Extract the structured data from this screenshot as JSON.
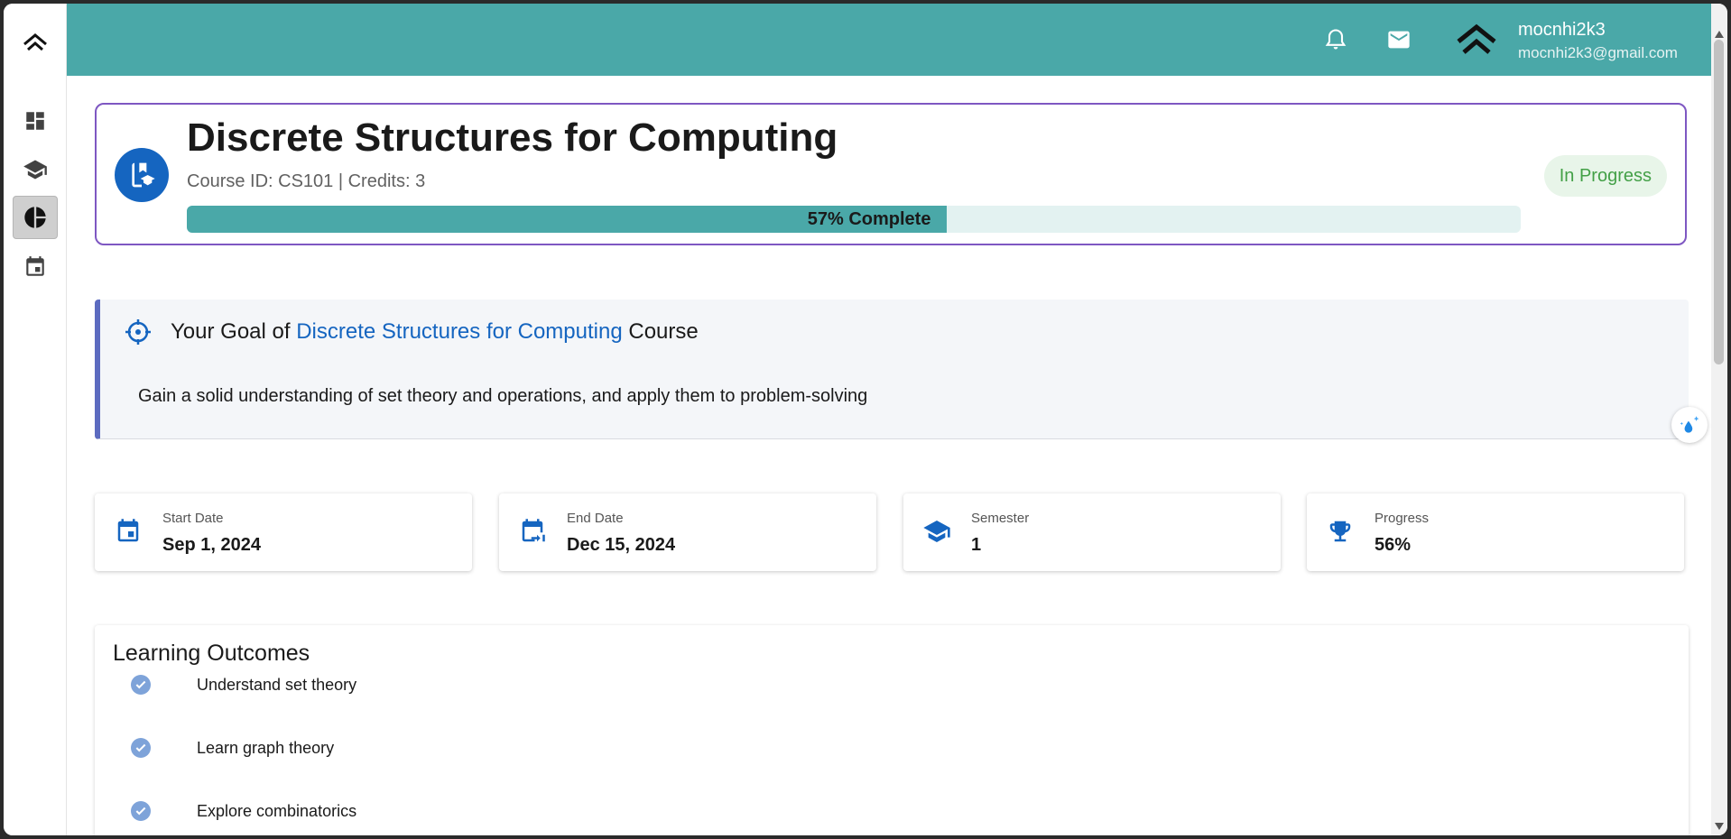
{
  "user": {
    "name": "mocnhi2k3",
    "email": "mocnhi2k3@gmail.com"
  },
  "course": {
    "title": "Discrete Structures for Computing",
    "meta": "Course ID: CS101 | Credits: 3",
    "progress_label": "57% Complete",
    "progress_fraction": 0.57,
    "status": "In Progress"
  },
  "goal": {
    "prefix": "Your Goal of",
    "course_link": "Discrete Structures for Computing",
    "suffix": "Course",
    "text": "Gain a solid understanding of set theory and operations, and apply them to problem-solving"
  },
  "stats": [
    {
      "label": "Start Date",
      "value": "Sep 1, 2024",
      "icon": "calendar-icon"
    },
    {
      "label": "End Date",
      "value": "Dec 15, 2024",
      "icon": "calendar-end-icon"
    },
    {
      "label": "Semester",
      "value": "1",
      "icon": "school-icon"
    },
    {
      "label": "Progress",
      "value": "56%",
      "icon": "trophy-icon"
    }
  ],
  "outcomes": {
    "title": "Learning Outcomes",
    "items": [
      "Understand set theory",
      "Learn graph theory",
      "Explore combinatorics"
    ]
  },
  "colors": {
    "topbar": "#4aa8a8",
    "accent": "#1565c0",
    "border": "#7e57c2",
    "status": "#43a047"
  }
}
